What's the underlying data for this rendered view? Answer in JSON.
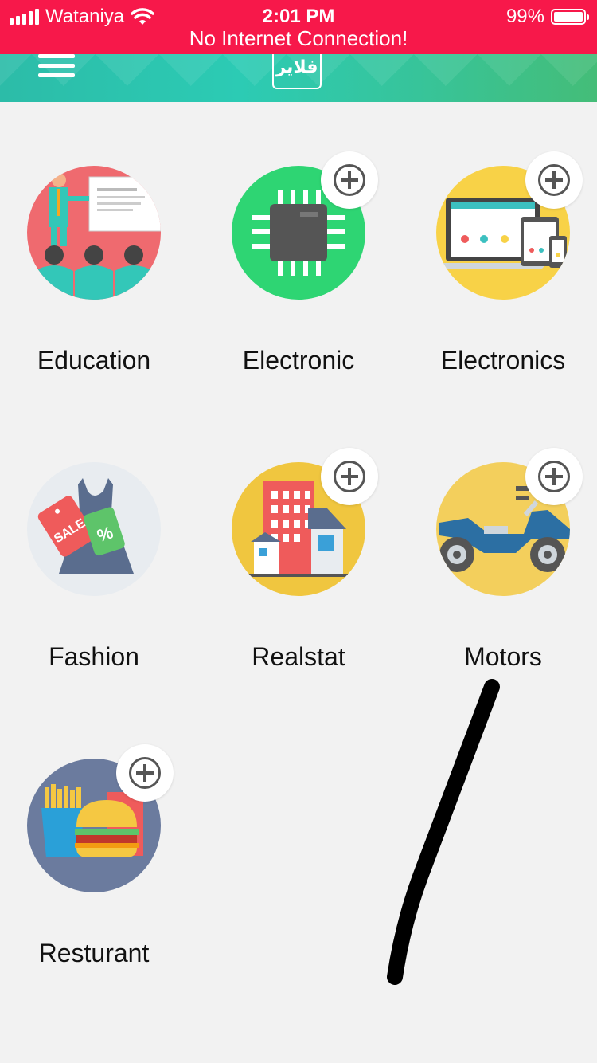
{
  "status_bar": {
    "carrier": "Wataniya",
    "time": "2:01 PM",
    "battery_percent": "99%",
    "banner": "No Internet Connection!",
    "color": "#f7184a"
  },
  "nav": {
    "menu_icon": "hamburger-menu-icon",
    "logo_text": "فلاير"
  },
  "categories": [
    {
      "label": "Education",
      "has_add": false,
      "bg": "#ef6a6f"
    },
    {
      "label": "Electronic",
      "has_add": true,
      "bg": "#2ed573"
    },
    {
      "label": "Electronics",
      "has_add": true,
      "bg": "#f8d247"
    },
    {
      "label": "Fashion",
      "has_add": false,
      "bg": "#e8ecf0"
    },
    {
      "label": "Realstat",
      "has_add": true,
      "bg": "#f0c63f"
    },
    {
      "label": "Motors",
      "has_add": true,
      "bg": "#f3cf5c"
    },
    {
      "label": "Resturant",
      "has_add": true,
      "bg": "#6b7b9e"
    }
  ]
}
